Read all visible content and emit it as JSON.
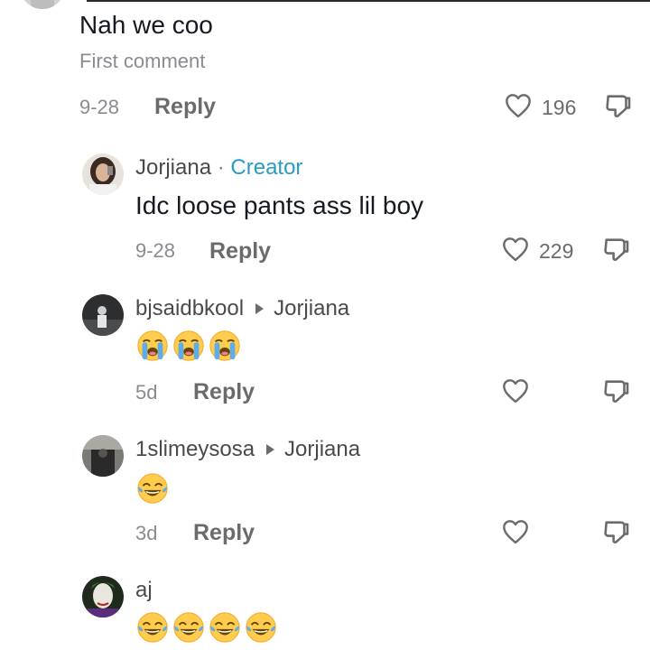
{
  "comments": [
    {
      "text": "Nah we coo",
      "sub": "First comment",
      "date": "9-28",
      "reply": "Reply",
      "likes": "196"
    },
    {
      "username": "Jorjiana",
      "separator": "·",
      "badge": "Creator",
      "text": "Idc loose pants ass lil boy",
      "date": "9-28",
      "reply": "Reply",
      "likes": "229"
    },
    {
      "username": "bjsaidbkool",
      "reply_to": "Jorjiana",
      "emoji": "loudly-crying-face",
      "emoji_count": 3,
      "date": "5d",
      "reply": "Reply"
    },
    {
      "username": "1slimeysosa",
      "reply_to": "Jorjiana",
      "emoji": "tears-of-joy-face",
      "emoji_count": 1,
      "date": "3d",
      "reply": "Reply"
    },
    {
      "username": "aj",
      "emoji": "tears-of-joy-face",
      "emoji_count": 4
    }
  ],
  "colors": {
    "creator_badge": "#2a9cc4",
    "muted_text": "#8a8b91",
    "action_gray": "#6b6b6b"
  },
  "icons": [
    "heart-icon",
    "dislike-icon",
    "reply-arrow-icon"
  ]
}
